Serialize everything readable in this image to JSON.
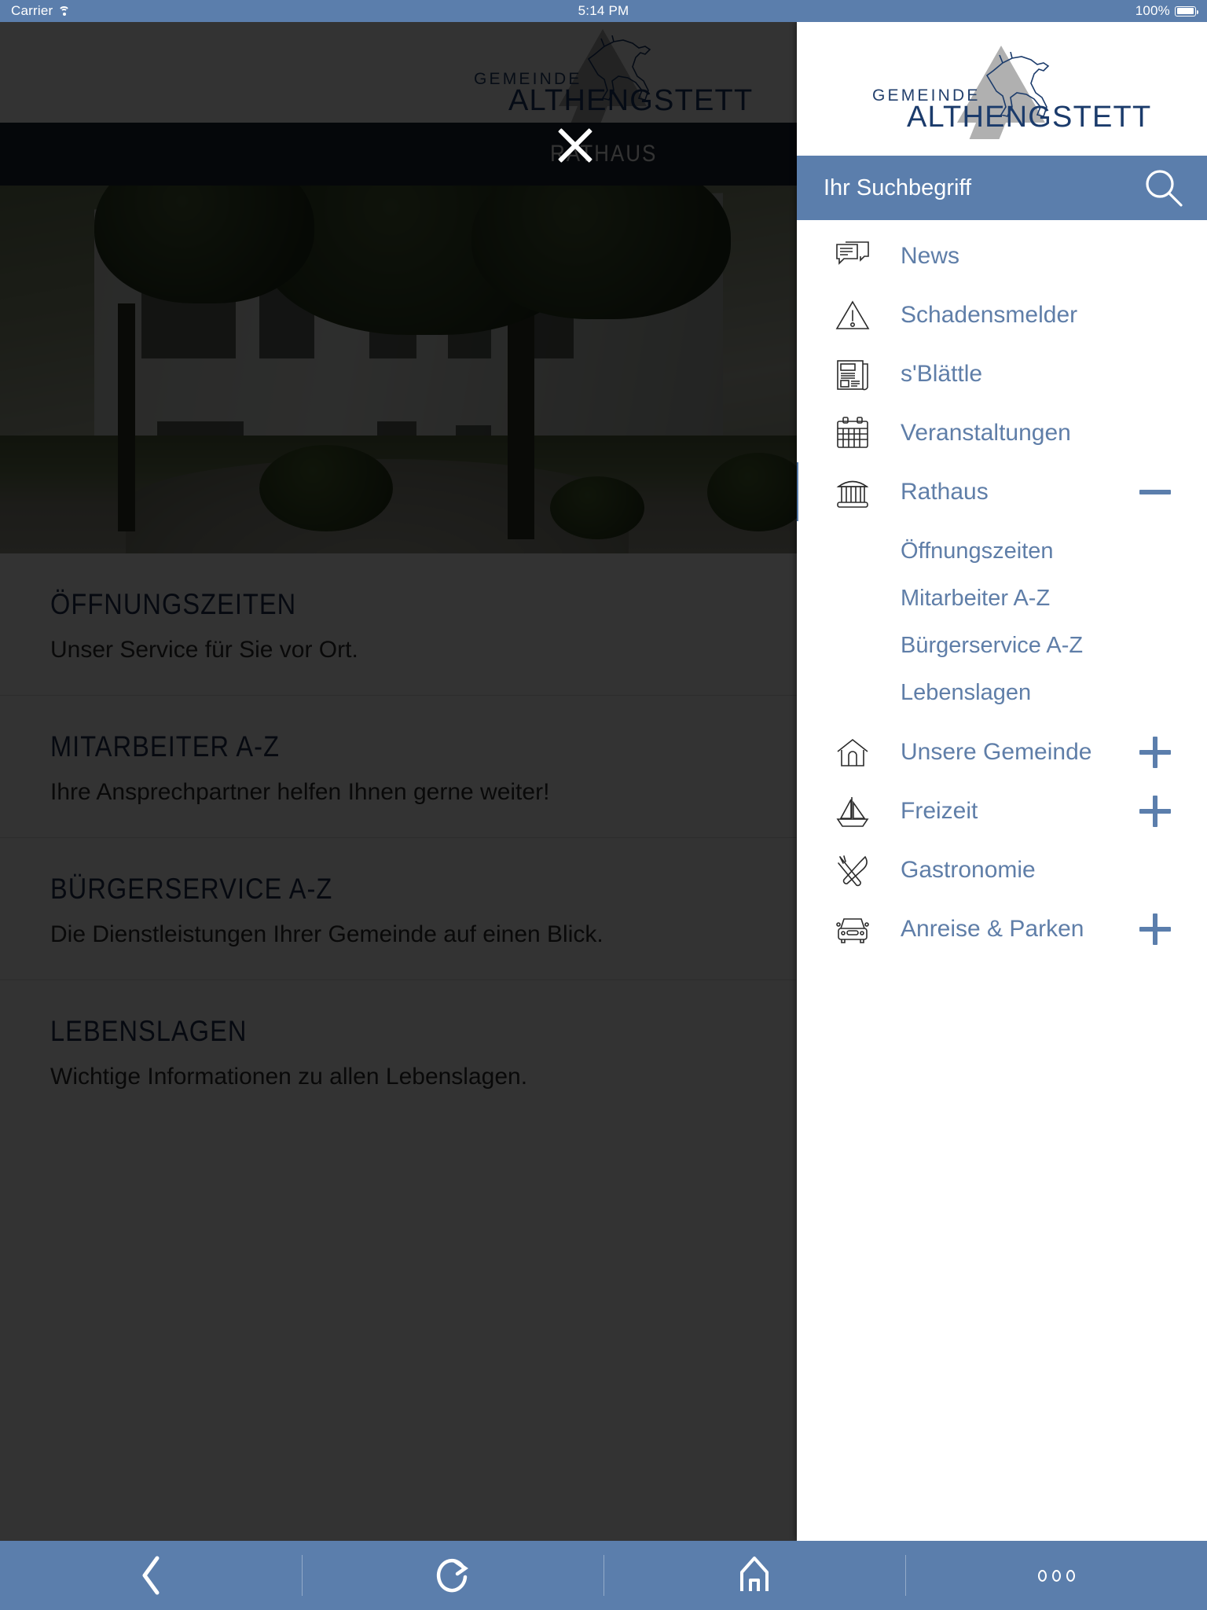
{
  "statusbar": {
    "carrier": "Carrier",
    "time": "5:14 PM",
    "battery": "100%",
    "wifi_icon": "wifi-icon",
    "battery_icon": "battery-full-icon"
  },
  "brand": {
    "line1": "GEMEINDE",
    "line2": "ALTHENGSTETT",
    "logo_icon": "althengstett-horse-logo"
  },
  "page": {
    "title": "RATHAUS",
    "close_icon": "close-icon",
    "hero_alt": "rathaus-building-photo",
    "items": [
      {
        "title": "ÖFFNUNGSZEITEN",
        "subtitle": "Unser Service für Sie vor Ort."
      },
      {
        "title": "MITARBEITER A-Z",
        "subtitle": "Ihre Ansprechpartner helfen Ihnen gerne weiter!"
      },
      {
        "title": "BÜRGERSERVICE A-Z",
        "subtitle": "Die Dienstleistungen Ihrer Gemeinde auf einen Blick."
      },
      {
        "title": "LEBENSLAGEN",
        "subtitle": "Wichtige Informationen zu allen Lebenslagen."
      }
    ]
  },
  "sidebar": {
    "search": {
      "placeholder": "Ihr Suchbegriff",
      "value": "",
      "icon": "search-icon"
    },
    "items": [
      {
        "label": "News",
        "icon": "chat-bubbles-icon",
        "toggle": "none"
      },
      {
        "label": "Schadensmelder",
        "icon": "warning-triangle-icon",
        "toggle": "none"
      },
      {
        "label": "s'Blättle",
        "icon": "newspaper-icon",
        "toggle": "none"
      },
      {
        "label": "Veranstaltungen",
        "icon": "calendar-icon",
        "toggle": "none"
      },
      {
        "label": "Rathaus",
        "icon": "town-hall-icon",
        "toggle": "minus",
        "active": true
      },
      {
        "label": "Unsere Gemeinde",
        "icon": "house-icon",
        "toggle": "plus"
      },
      {
        "label": "Freizeit",
        "icon": "sailboat-icon",
        "toggle": "plus"
      },
      {
        "label": "Gastronomie",
        "icon": "fork-knife-icon",
        "toggle": "none"
      },
      {
        "label": "Anreise & Parken",
        "icon": "car-front-icon",
        "toggle": "plus"
      }
    ],
    "rathaus_submenu": [
      {
        "label": "Öffnungszeiten"
      },
      {
        "label": "Mitarbeiter A-Z"
      },
      {
        "label": "Bürgerservice A-Z"
      },
      {
        "label": "Lebenslagen"
      }
    ]
  },
  "toolbar": {
    "back": "back-chevron-icon",
    "reload": "reload-icon",
    "home": "home-icon",
    "more": "more-dots-icon"
  },
  "colors": {
    "accent": "#5b7eac",
    "link": "#5f7ea8",
    "title_bar": "#1d2733",
    "heading": "#1e3050",
    "brand_dark": "#1b3b6b",
    "brand_gray": "#b0b0b0"
  }
}
